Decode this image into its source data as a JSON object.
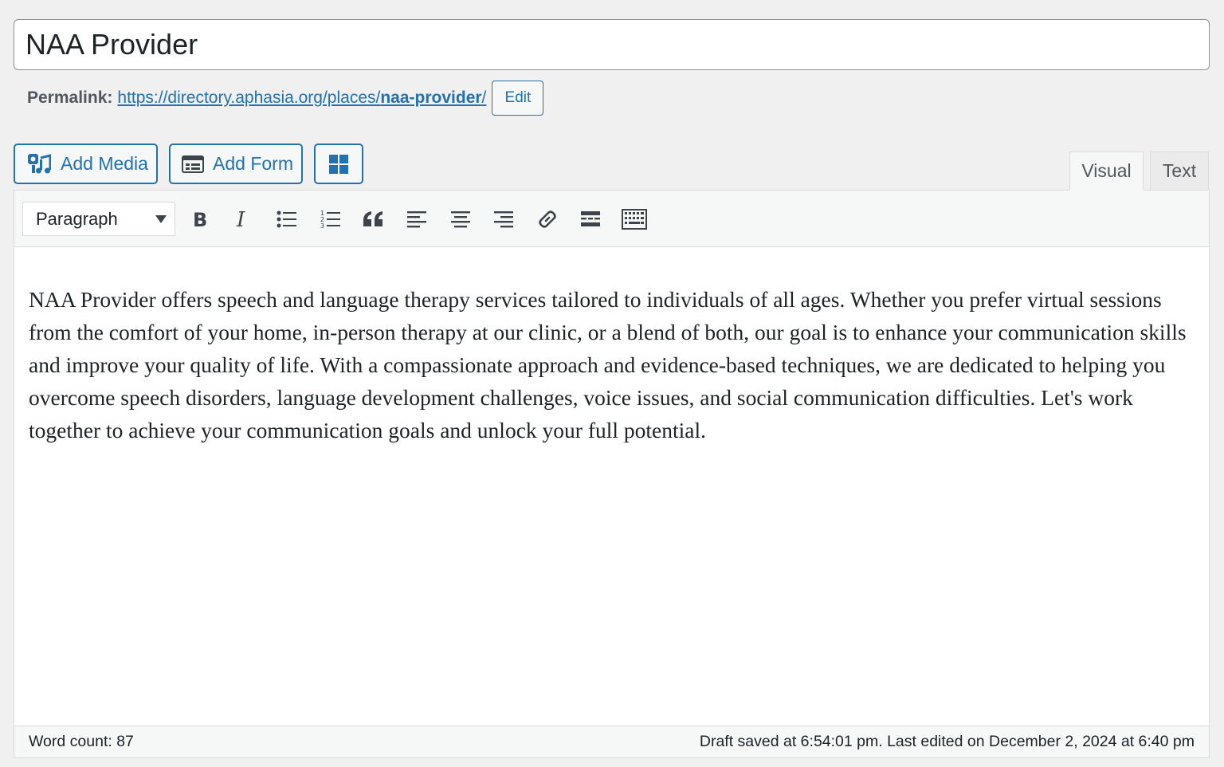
{
  "title": {
    "value": "NAA Provider"
  },
  "permalink": {
    "label": "Permalink:",
    "base": "https://directory.aphasia.org/places/",
    "slug": "naa-provider",
    "trailing": "/",
    "edit_label": "Edit"
  },
  "media_buttons": {
    "add_media": "Add Media",
    "add_form": "Add Form"
  },
  "tabs": {
    "visual": "Visual",
    "text": "Text"
  },
  "toolbar": {
    "format": "Paragraph",
    "buttons": [
      "bold-icon",
      "italic-icon",
      "bulleted-list-icon",
      "numbered-list-icon",
      "blockquote-icon",
      "align-left-icon",
      "align-center-icon",
      "align-right-icon",
      "link-icon",
      "read-more-icon",
      "toolbar-toggle-icon"
    ]
  },
  "content": {
    "body": "NAA Provider offers speech and language therapy services tailored to individuals of all ages. Whether you prefer virtual sessions from the comfort of your home, in-person therapy at our clinic, or a blend of both, our goal is to enhance your communication skills and improve your quality of life. With a compassionate approach and evidence-based techniques, we are dedicated to helping you overcome speech disorders, language development challenges, voice issues, and social communication difficulties. Let's work together to achieve your communication goals and unlock your full potential."
  },
  "status": {
    "word_count": "Word count: 87",
    "saved": "Draft saved at 6:54:01 pm. Last edited on December 2, 2024 at 6:40 pm"
  },
  "colors": {
    "accent": "#2271b1",
    "icon": "#3c434a"
  }
}
